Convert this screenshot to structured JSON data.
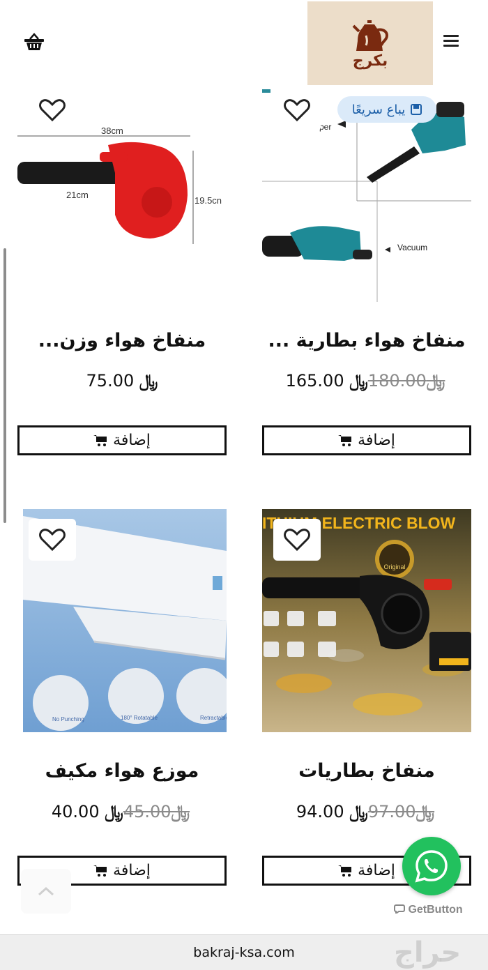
{
  "header": {
    "logo_text": "بكرج",
    "menu_icon": "hamburger-icon",
    "cart_icon": "basket-icon"
  },
  "products": [
    {
      "title": "منفاخ هواء بطارية ...",
      "price_old": "180.00",
      "price_new": "165.00",
      "currency": "﷼",
      "add_label": "إضافة",
      "badge": "يباع سريعًا",
      "image_labels": [
        "per",
        "Vacuum"
      ]
    },
    {
      "title": "منفاخ هواء وزن...",
      "price_old": "",
      "price_new": "75.00",
      "currency": "﷼",
      "add_label": "إضافة",
      "image_labels": [
        "38cm",
        "21cm",
        "19.5cn"
      ]
    },
    {
      "title": "منفاخ بطاريات",
      "price_old": "97.00",
      "price_new": "94.00",
      "currency": "﷼",
      "add_label": "إضافة",
      "image_labels": [
        "ITHIUM ELECTRIC BLOW",
        "Original"
      ]
    },
    {
      "title": "موزع هواء مكيف",
      "price_old": "45.00",
      "price_new": "40.00",
      "currency": "﷼",
      "add_label": "إضافة",
      "image_labels": [
        "No Punching",
        "180° Rotatable",
        "Retractable"
      ]
    }
  ],
  "floating": {
    "whatsapp_icon": "whatsapp-icon",
    "getbutton_label": "GetButton",
    "scroll_top_icon": "chevron-up-icon"
  },
  "browser": {
    "url": "bakraj-ksa.com",
    "watermark": "حراج"
  },
  "colors": {
    "logo_bg": "#ecddc9",
    "logo_brown": "#7a2a10",
    "badge_bg": "#dbeaf9",
    "badge_text": "#1c5fa8",
    "whatsapp": "#22c15e"
  }
}
